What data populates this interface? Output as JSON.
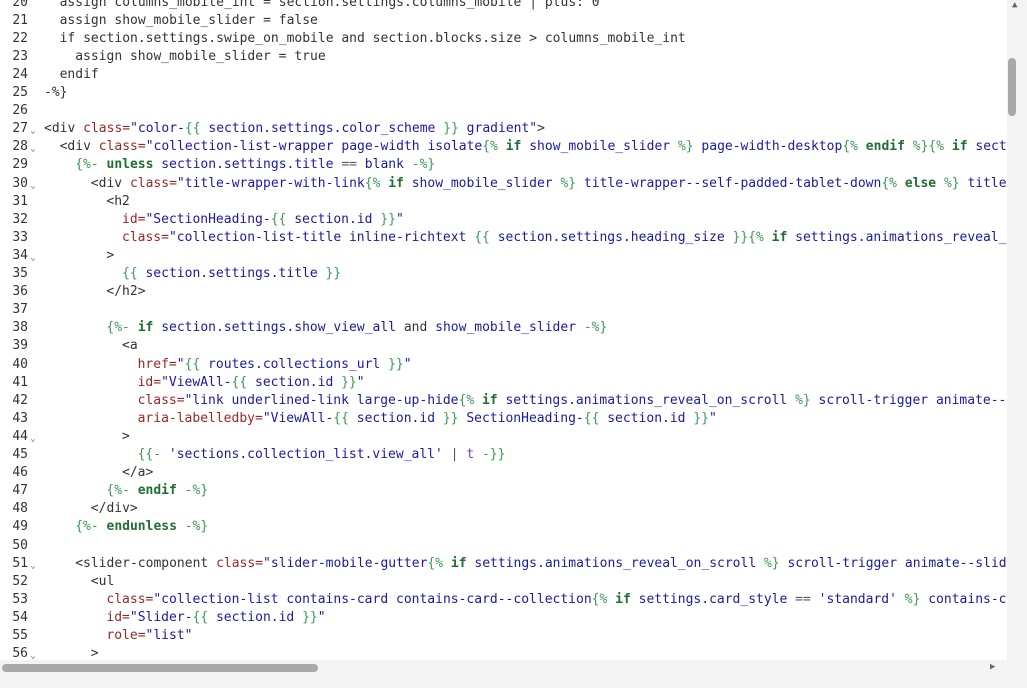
{
  "editor": {
    "lines": [
      {
        "n": "20",
        "fold": false,
        "indent": 2,
        "tokens": [
          [
            "tx",
            "assign columns_mobile_int = section.settings.columns_mobile | plus: 0"
          ]
        ]
      },
      {
        "n": "21",
        "fold": false,
        "indent": 2,
        "tokens": [
          [
            "tx",
            "assign show_mobile_slider = false"
          ]
        ]
      },
      {
        "n": "22",
        "fold": false,
        "indent": 2,
        "tokens": [
          [
            "tx",
            "if section.settings.swipe_on_mobile and section.blocks.size > columns_mobile_int"
          ]
        ]
      },
      {
        "n": "23",
        "fold": false,
        "indent": 4,
        "tokens": [
          [
            "tx",
            "assign show_mobile_slider = true"
          ]
        ]
      },
      {
        "n": "24",
        "fold": false,
        "indent": 2,
        "tokens": [
          [
            "tx",
            "endif"
          ]
        ]
      },
      {
        "n": "25",
        "fold": false,
        "indent": 0,
        "tokens": [
          [
            "tx",
            "-%}"
          ]
        ]
      },
      {
        "n": "26",
        "fold": false,
        "indent": 0,
        "tokens": []
      },
      {
        "n": "27",
        "fold": true,
        "indent": 0,
        "tokens": [
          [
            "tx",
            "<div "
          ],
          [
            "at",
            "class="
          ],
          [
            "st",
            "\"color-"
          ],
          [
            "dl",
            "{{"
          ],
          [
            "vr",
            " section.settings.color_scheme "
          ],
          [
            "dl",
            "}}"
          ],
          [
            "st",
            " gradient\""
          ],
          [
            "tx",
            ">"
          ]
        ]
      },
      {
        "n": "28",
        "fold": true,
        "indent": 2,
        "tokens": [
          [
            "tx",
            "<div "
          ],
          [
            "at",
            "class="
          ],
          [
            "st",
            "\"collection-list-wrapper page-width isolate"
          ],
          [
            "dl",
            "{%"
          ],
          [
            "kw",
            " if "
          ],
          [
            "vr",
            "show_mobile_slider "
          ],
          [
            "dl",
            "%}"
          ],
          [
            "st",
            " page-width-desktop"
          ],
          [
            "dl",
            "{%"
          ],
          [
            "kw",
            " endif "
          ],
          [
            "dl",
            "%}{%"
          ],
          [
            "kw",
            " if "
          ],
          [
            "vr",
            "sect"
          ]
        ]
      },
      {
        "n": "29",
        "fold": false,
        "indent": 4,
        "tokens": [
          [
            "dl",
            "{%-"
          ],
          [
            "kw",
            " unless "
          ],
          [
            "vr",
            "section.settings.title "
          ],
          [
            "op",
            "=="
          ],
          [
            "vr",
            " blank "
          ],
          [
            "dl",
            "-%}"
          ]
        ]
      },
      {
        "n": "30",
        "fold": true,
        "indent": 6,
        "tokens": [
          [
            "tx",
            "<div "
          ],
          [
            "at",
            "class="
          ],
          [
            "st",
            "\"title-wrapper-with-link"
          ],
          [
            "dl",
            "{%"
          ],
          [
            "kw",
            " if "
          ],
          [
            "vr",
            "show_mobile_slider "
          ],
          [
            "dl",
            "%}"
          ],
          [
            "st",
            " title-wrapper--self-padded-tablet-down"
          ],
          [
            "dl",
            "{%"
          ],
          [
            "kw",
            " else "
          ],
          [
            "dl",
            "%}"
          ],
          [
            "st",
            " title"
          ]
        ]
      },
      {
        "n": "31",
        "fold": false,
        "indent": 8,
        "tokens": [
          [
            "tx",
            "<h2"
          ]
        ]
      },
      {
        "n": "32",
        "fold": false,
        "indent": 10,
        "tokens": [
          [
            "at",
            "id="
          ],
          [
            "st",
            "\"SectionHeading-"
          ],
          [
            "dl",
            "{{"
          ],
          [
            "vr",
            " section.id "
          ],
          [
            "dl",
            "}}"
          ],
          [
            "st",
            "\""
          ]
        ]
      },
      {
        "n": "33",
        "fold": false,
        "indent": 10,
        "tokens": [
          [
            "at",
            "class="
          ],
          [
            "st",
            "\"collection-list-title inline-richtext "
          ],
          [
            "dl",
            "{{"
          ],
          [
            "vr",
            " section.settings.heading_size "
          ],
          [
            "dl",
            "}}{%"
          ],
          [
            "kw",
            " if "
          ],
          [
            "vr",
            "settings.animations_reveal_"
          ]
        ]
      },
      {
        "n": "34",
        "fold": true,
        "indent": 8,
        "tokens": [
          [
            "tx",
            ">"
          ]
        ]
      },
      {
        "n": "35",
        "fold": false,
        "indent": 10,
        "tokens": [
          [
            "dl",
            "{{"
          ],
          [
            "vr",
            " section.settings.title "
          ],
          [
            "dl",
            "}}"
          ]
        ]
      },
      {
        "n": "36",
        "fold": false,
        "indent": 8,
        "tokens": [
          [
            "tx",
            "</h2>"
          ]
        ]
      },
      {
        "n": "37",
        "fold": false,
        "indent": 0,
        "tokens": []
      },
      {
        "n": "38",
        "fold": false,
        "indent": 8,
        "tokens": [
          [
            "dl",
            "{%-"
          ],
          [
            "kw",
            " if "
          ],
          [
            "vr",
            "section.settings.show_view_all "
          ],
          [
            "tx",
            "and "
          ],
          [
            "vr",
            "show_mobile_slider "
          ],
          [
            "dl",
            "-%}"
          ]
        ]
      },
      {
        "n": "39",
        "fold": false,
        "indent": 10,
        "tokens": [
          [
            "tx",
            "<a"
          ]
        ]
      },
      {
        "n": "40",
        "fold": false,
        "indent": 12,
        "tokens": [
          [
            "at",
            "href="
          ],
          [
            "st",
            "\""
          ],
          [
            "dl",
            "{{"
          ],
          [
            "vr",
            " routes.collections_url "
          ],
          [
            "dl",
            "}}"
          ],
          [
            "st",
            "\""
          ]
        ]
      },
      {
        "n": "41",
        "fold": false,
        "indent": 12,
        "tokens": [
          [
            "at",
            "id="
          ],
          [
            "st",
            "\"ViewAll-"
          ],
          [
            "dl",
            "{{"
          ],
          [
            "vr",
            " section.id "
          ],
          [
            "dl",
            "}}"
          ],
          [
            "st",
            "\""
          ]
        ]
      },
      {
        "n": "42",
        "fold": false,
        "indent": 12,
        "tokens": [
          [
            "at",
            "class="
          ],
          [
            "st",
            "\"link underlined-link large-up-hide"
          ],
          [
            "dl",
            "{%"
          ],
          [
            "kw",
            " if "
          ],
          [
            "vr",
            "settings.animations_reveal_on_scroll "
          ],
          [
            "dl",
            "%}"
          ],
          [
            "st",
            " scroll-trigger animate--"
          ]
        ]
      },
      {
        "n": "43",
        "fold": false,
        "indent": 12,
        "tokens": [
          [
            "at",
            "aria-labelledby="
          ],
          [
            "st",
            "\"ViewAll-"
          ],
          [
            "dl",
            "{{"
          ],
          [
            "vr",
            " section.id "
          ],
          [
            "dl",
            "}}"
          ],
          [
            "st",
            " SectionHeading-"
          ],
          [
            "dl",
            "{{"
          ],
          [
            "vr",
            " section.id "
          ],
          [
            "dl",
            "}}"
          ],
          [
            "st",
            "\""
          ]
        ]
      },
      {
        "n": "44",
        "fold": true,
        "indent": 10,
        "tokens": [
          [
            "tx",
            ">"
          ]
        ]
      },
      {
        "n": "45",
        "fold": false,
        "indent": 12,
        "tokens": [
          [
            "dl",
            "{{-"
          ],
          [
            "st",
            " 'sections.collection_list.view_all' "
          ],
          [
            "op",
            "|"
          ],
          [
            "fl",
            " t "
          ],
          [
            "dl",
            "-}}"
          ]
        ]
      },
      {
        "n": "46",
        "fold": false,
        "indent": 10,
        "tokens": [
          [
            "tx",
            "</a>"
          ]
        ]
      },
      {
        "n": "47",
        "fold": false,
        "indent": 8,
        "tokens": [
          [
            "dl",
            "{%-"
          ],
          [
            "kw",
            " endif "
          ],
          [
            "dl",
            "-%}"
          ]
        ]
      },
      {
        "n": "48",
        "fold": false,
        "indent": 6,
        "tokens": [
          [
            "tx",
            "</div>"
          ]
        ]
      },
      {
        "n": "49",
        "fold": false,
        "indent": 4,
        "tokens": [
          [
            "dl",
            "{%-"
          ],
          [
            "kw",
            " endunless "
          ],
          [
            "dl",
            "-%}"
          ]
        ]
      },
      {
        "n": "50",
        "fold": false,
        "indent": 0,
        "tokens": []
      },
      {
        "n": "51",
        "fold": true,
        "indent": 4,
        "tokens": [
          [
            "tx",
            "<slider-component "
          ],
          [
            "at",
            "class="
          ],
          [
            "st",
            "\"slider-mobile-gutter"
          ],
          [
            "dl",
            "{%"
          ],
          [
            "kw",
            " if "
          ],
          [
            "vr",
            "settings.animations_reveal_on_scroll "
          ],
          [
            "dl",
            "%}"
          ],
          [
            "st",
            " scroll-trigger animate--slid"
          ]
        ]
      },
      {
        "n": "52",
        "fold": false,
        "indent": 6,
        "tokens": [
          [
            "tx",
            "<ul"
          ]
        ]
      },
      {
        "n": "53",
        "fold": false,
        "indent": 8,
        "tokens": [
          [
            "at",
            "class="
          ],
          [
            "st",
            "\"collection-list contains-card contains-card--collection"
          ],
          [
            "dl",
            "{%"
          ],
          [
            "kw",
            " if "
          ],
          [
            "vr",
            "settings.card_style "
          ],
          [
            "op",
            "=="
          ],
          [
            "st",
            " 'standard' "
          ],
          [
            "dl",
            "%}"
          ],
          [
            "st",
            " contains-c"
          ]
        ]
      },
      {
        "n": "54",
        "fold": false,
        "indent": 8,
        "tokens": [
          [
            "at",
            "id="
          ],
          [
            "st",
            "\"Slider-"
          ],
          [
            "dl",
            "{{"
          ],
          [
            "vr",
            " section.id "
          ],
          [
            "dl",
            "}}"
          ],
          [
            "st",
            "\""
          ]
        ]
      },
      {
        "n": "55",
        "fold": false,
        "indent": 8,
        "tokens": [
          [
            "at",
            "role="
          ],
          [
            "st",
            "\"list\""
          ]
        ]
      },
      {
        "n": "56",
        "fold": true,
        "indent": 6,
        "tokens": [
          [
            "tx",
            ">"
          ]
        ]
      }
    ]
  },
  "icons": {
    "fold": "chevron-down-icon",
    "scroll_up": "triangle-up-icon",
    "scroll_right": "triangle-right-icon"
  },
  "scroll": {
    "vertical_position": 0.09,
    "horizontal_position": 0.0
  }
}
